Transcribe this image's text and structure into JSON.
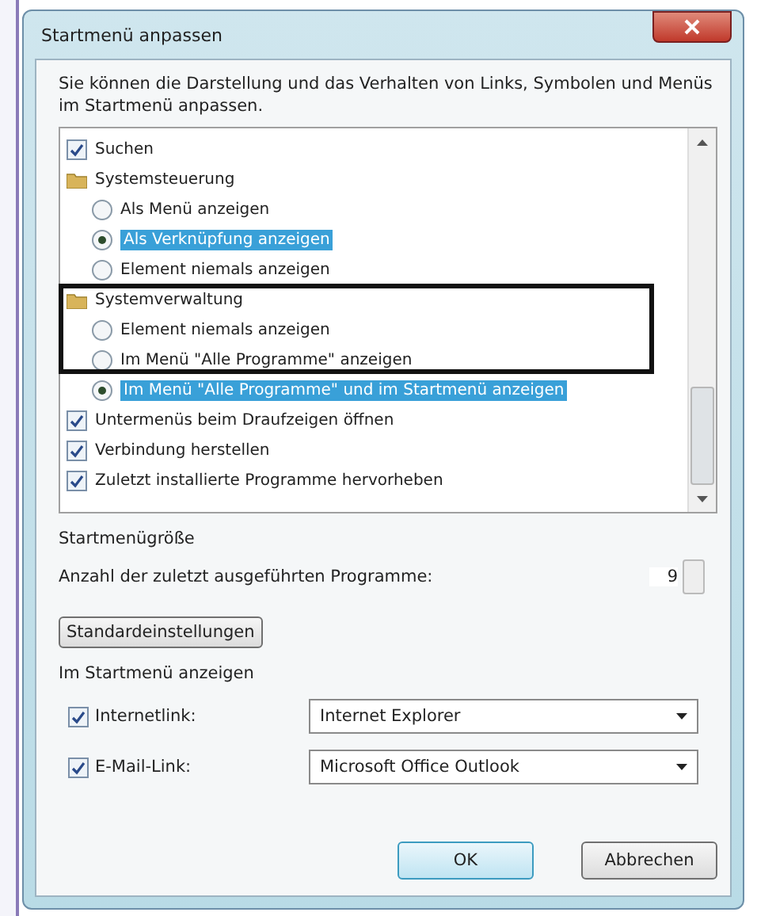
{
  "window": {
    "title": "Startmenü anpassen"
  },
  "description": "Sie können die Darstellung und das Verhalten von Links, Symbolen und Menüs im Startmenü anpassen.",
  "options": [
    {
      "kind": "checkbox",
      "label": "Suchen",
      "checked": true
    },
    {
      "kind": "group",
      "label": "Systemsteuerung",
      "children": [
        {
          "kind": "radio",
          "label": "Als Menü anzeigen",
          "selected": false
        },
        {
          "kind": "radio",
          "label": "Als Verknüpfung anzeigen",
          "selected": true
        },
        {
          "kind": "radio",
          "label": "Element niemals anzeigen",
          "selected": false
        }
      ]
    },
    {
      "kind": "group",
      "label": "Systemverwaltung",
      "children": [
        {
          "kind": "radio",
          "label": "Element niemals anzeigen",
          "selected": false
        },
        {
          "kind": "radio",
          "label": "Im Menü \"Alle Programme\" anzeigen",
          "selected": false
        },
        {
          "kind": "radio",
          "label": "Im Menü \"Alle Programme\" und im Startmenü anzeigen",
          "selected": true
        }
      ]
    },
    {
      "kind": "checkbox",
      "label": "Untermenüs beim Draufzeigen öffnen",
      "checked": true
    },
    {
      "kind": "checkbox",
      "label": "Verbindung herstellen",
      "checked": true
    },
    {
      "kind": "checkbox",
      "label": "Zuletzt installierte Programme hervorheben",
      "checked": true
    }
  ],
  "size": {
    "heading": "Startmenügröße",
    "label": "Anzahl der zuletzt ausgeführten Programme:",
    "value": "9"
  },
  "defaults_button": "Standardeinstellungen",
  "show": {
    "heading": "Im Startmenü anzeigen",
    "links": [
      {
        "label": "Internetlink:",
        "checked": true,
        "value": "Internet Explorer"
      },
      {
        "label": "E-Mail-Link:",
        "checked": true,
        "value": "Microsoft Office Outlook"
      }
    ]
  },
  "buttons": [
    {
      "label": "OK",
      "kind": "default"
    },
    {
      "label": "Abbrechen",
      "kind": "normal"
    }
  ]
}
